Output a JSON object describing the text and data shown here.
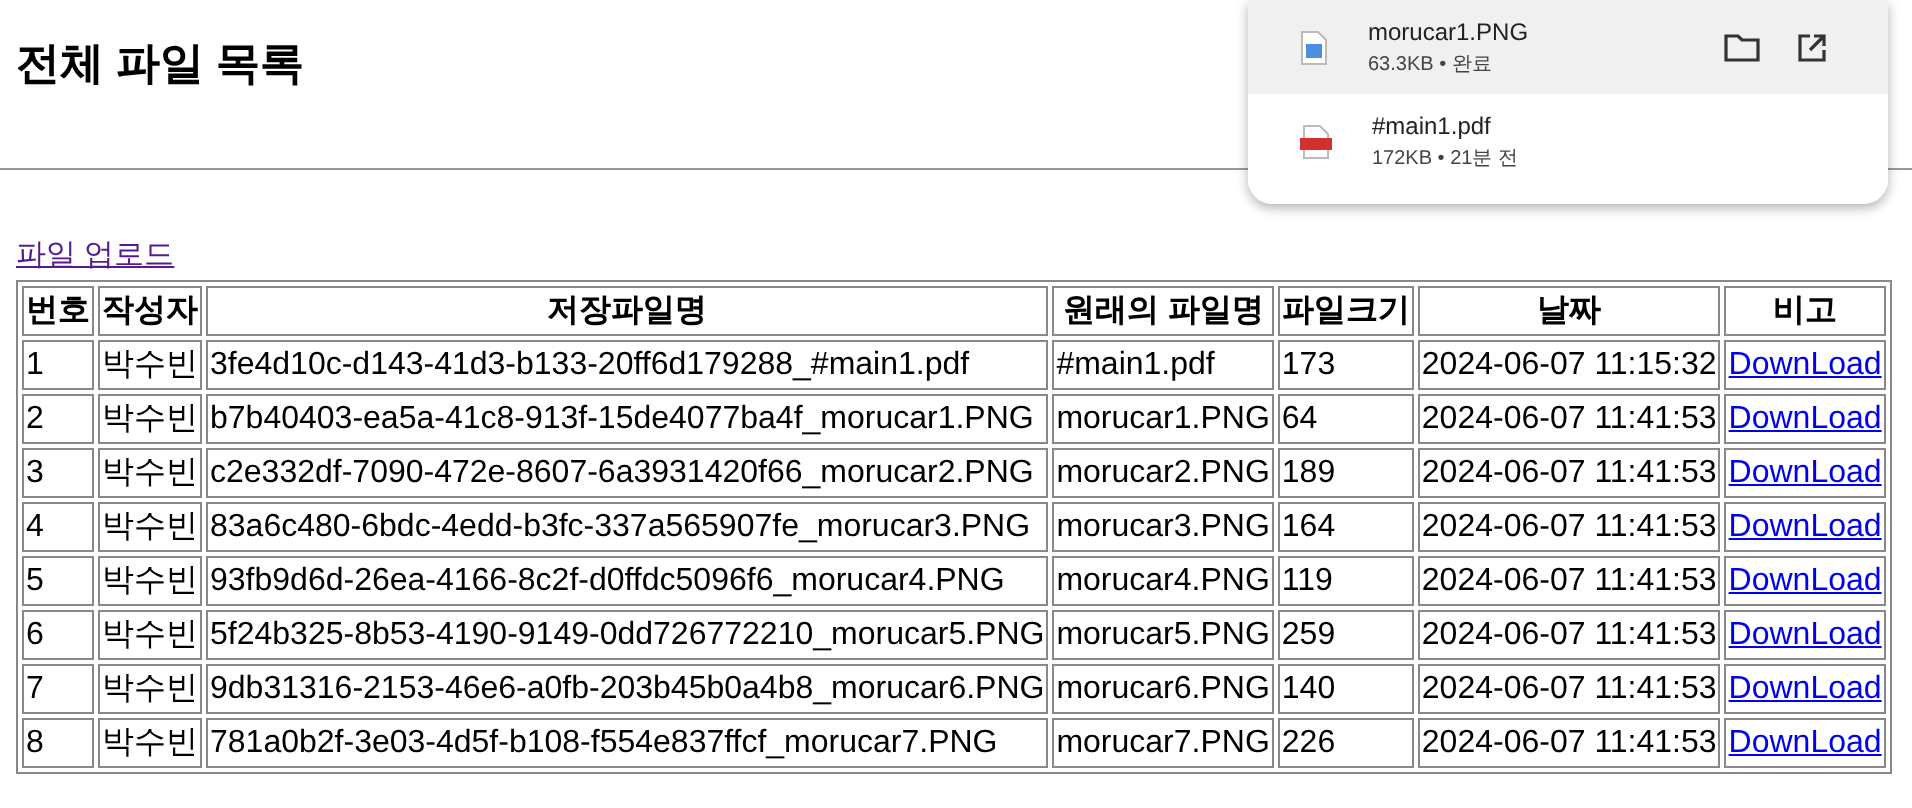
{
  "title": "전체 파일 목록",
  "upload_link": {
    "label": "파일 업로드",
    "visited": true
  },
  "table": {
    "columns": [
      "번호",
      "작성자",
      "저장파일명",
      "원래의 파일명",
      "파일크기",
      "날짜",
      "비고"
    ],
    "rows": [
      [
        "1",
        "박수빈",
        "3fe4d10c-d143-41d3-b133-20ff6d179288_#main1.pdf",
        "#main1.pdf",
        "173",
        "2024-06-07 11:15:32",
        "DownLoad"
      ],
      [
        "2",
        "박수빈",
        "b7b40403-ea5a-41c8-913f-15de4077ba4f_morucar1.PNG",
        "morucar1.PNG",
        "64",
        "2024-06-07 11:41:53",
        "DownLoad"
      ],
      [
        "3",
        "박수빈",
        "c2e332df-7090-472e-8607-6a3931420f66_morucar2.PNG",
        "morucar2.PNG",
        "189",
        "2024-06-07 11:41:53",
        "DownLoad"
      ],
      [
        "4",
        "박수빈",
        "83a6c480-6bdc-4edd-b3fc-337a565907fe_morucar3.PNG",
        "morucar3.PNG",
        "164",
        "2024-06-07 11:41:53",
        "DownLoad"
      ],
      [
        "5",
        "박수빈",
        "93fb9d6d-26ea-4166-8c2f-d0ffdc5096f6_morucar4.PNG",
        "morucar4.PNG",
        "119",
        "2024-06-07 11:41:53",
        "DownLoad"
      ],
      [
        "6",
        "박수빈",
        "5f24b325-8b53-4190-9149-0dd726772210_morucar5.PNG",
        "morucar5.PNG",
        "259",
        "2024-06-07 11:41:53",
        "DownLoad"
      ],
      [
        "7",
        "박수빈",
        "9db31316-2153-46e6-a0fb-203b45b0a4b8_morucar6.PNG",
        "morucar6.PNG",
        "140",
        "2024-06-07 11:41:53",
        "DownLoad"
      ],
      [
        "8",
        "박수빈",
        "781a0b2f-3e03-4d5f-b108-f554e837ffcf_morucar7.PNG",
        "morucar7.PNG",
        "226",
        "2024-06-07 11:41:53",
        "DownLoad"
      ]
    ]
  },
  "downloads_panel": {
    "items": [
      {
        "kind": "image",
        "name": "morucar1.PNG",
        "detail": "63.3KB • 완료",
        "highlighted": true
      },
      {
        "kind": "pdf",
        "name": "#main1.pdf",
        "detail": "172KB • 21분 전",
        "highlighted": false
      }
    ]
  }
}
